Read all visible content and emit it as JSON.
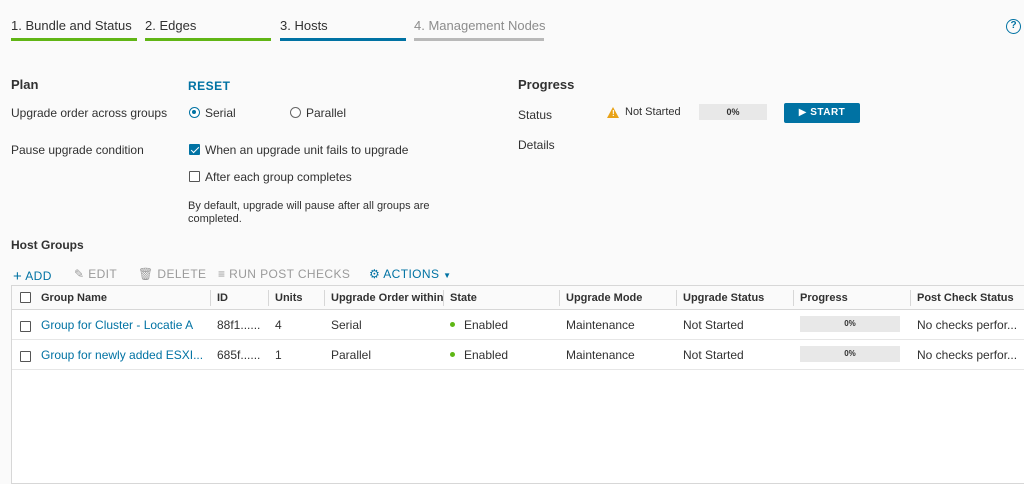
{
  "tabs": [
    {
      "label": "1. Bundle and Status",
      "color": "#60b515"
    },
    {
      "label": "2. Edges",
      "color": "#60b515"
    },
    {
      "label": "3. Hosts",
      "color": "#0072a3"
    },
    {
      "label": "4. Management Nodes",
      "color": "#b9b9b9"
    }
  ],
  "help_icon": "question-circle-icon",
  "plan": {
    "title": "Plan",
    "reset_label": "RESET",
    "order_label": "Upgrade order across groups",
    "order_options": [
      "Serial",
      "Parallel"
    ],
    "order_selected": "Serial",
    "pause_label": "Pause upgrade condition",
    "pause_options": [
      {
        "label": "When an upgrade unit fails to upgrade",
        "checked": true
      },
      {
        "label": "After each group completes",
        "checked": false
      }
    ],
    "note": "By default, upgrade will pause after all groups are completed."
  },
  "progress": {
    "title": "Progress",
    "status_label": "Status",
    "status_value": "Not Started",
    "status_icon": "warning-triangle-icon",
    "percent": "0%",
    "start_label": "START",
    "details_label": "Details"
  },
  "host_groups": {
    "title": "Host Groups",
    "toolbar": {
      "add": "ADD",
      "edit": "EDIT",
      "delete": "DELETE",
      "run_post_checks": "RUN POST CHECKS",
      "actions": "ACTIONS"
    },
    "columns": [
      "Group Name",
      "ID",
      "Units",
      "Upgrade Order within",
      "State",
      "Upgrade Mode",
      "Upgrade Status",
      "Progress",
      "Post Check Status"
    ],
    "rows": [
      {
        "name": "Group for Cluster - Locatie A",
        "id": "88f1......",
        "units": "4",
        "order": "Serial",
        "state": "Enabled",
        "mode": "Maintenance",
        "status": "Not Started",
        "progress": "0%",
        "post_check": "No checks perfor..."
      },
      {
        "name": "Group for newly added ESXI...",
        "id": "685f......",
        "units": "1",
        "order": "Parallel",
        "state": "Enabled",
        "mode": "Maintenance",
        "status": "Not Started",
        "progress": "0%",
        "post_check": "No checks perfor..."
      }
    ]
  }
}
